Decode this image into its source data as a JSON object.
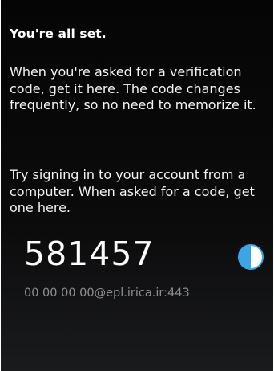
{
  "screen": {
    "heading": "You're all set.",
    "paragraph_1": "When you're asked for a verification code, get it here. The code changes frequently, so no need to memorize it.",
    "paragraph_2": "Try signing in to your account from a computer. When asked for a code, get one here."
  },
  "token": {
    "code": "581457",
    "account": "00 00 00 00@epl.irica.ir:443",
    "timer_icon": "countdown-pie-icon",
    "timer_fraction_remaining": 0.5
  },
  "colors": {
    "background": "#050505",
    "text": "#ffffff",
    "account_text": "#8e8e8e",
    "timer_accent": "#3aa6e6"
  }
}
